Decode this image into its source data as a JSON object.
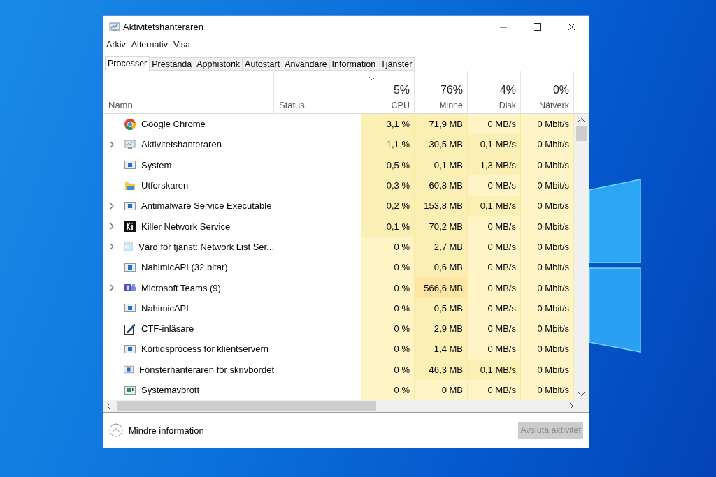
{
  "window": {
    "title": "Aktivitetshanteraren"
  },
  "menu": [
    "Arkiv",
    "Alternativ",
    "Visa"
  ],
  "tabs": [
    {
      "label": "Processer",
      "selected": true
    },
    {
      "label": "Prestanda",
      "selected": false
    },
    {
      "label": "Apphistorik",
      "selected": false
    },
    {
      "label": "Autostart",
      "selected": false
    },
    {
      "label": "Användare",
      "selected": false
    },
    {
      "label": "Information",
      "selected": false
    },
    {
      "label": "Tjänster",
      "selected": false
    }
  ],
  "columns": [
    {
      "kind": "name",
      "label": "Namn"
    },
    {
      "kind": "status",
      "label": "Status"
    },
    {
      "kind": "metric",
      "label": "CPU",
      "total": "5%",
      "sorted": true
    },
    {
      "kind": "metric",
      "label": "Minne",
      "total": "76%",
      "sorted": false
    },
    {
      "kind": "metric",
      "label": "Disk",
      "total": "4%",
      "sorted": false
    },
    {
      "kind": "metric",
      "label": "Nätverk",
      "total": "0%",
      "sorted": false
    }
  ],
  "rows": [
    {
      "name": "Google Chrome",
      "expandable": false,
      "kind": "chrome",
      "cells": [
        {
          "text": "3,1 %",
          "color": "#fcefb4"
        },
        {
          "text": "71,9 MB",
          "color": "#fcefb4"
        },
        {
          "text": "0 MB/s",
          "color": "#fff4c6"
        },
        {
          "text": "0 Mbit/s",
          "color": "#fff4c6"
        }
      ]
    },
    {
      "name": "Aktivitetshanteraren",
      "expandable": true,
      "kind": "taskmgr",
      "cells": [
        {
          "text": "1,1 %",
          "color": "#fcefb4"
        },
        {
          "text": "30,5 MB",
          "color": "#fcefb4"
        },
        {
          "text": "0,1 MB/s",
          "color": "#fcefb4"
        },
        {
          "text": "0 Mbit/s",
          "color": "#fff4c6"
        }
      ]
    },
    {
      "name": "System",
      "expandable": false,
      "kind": "app",
      "cells": [
        {
          "text": "0,5 %",
          "color": "#fcefb4"
        },
        {
          "text": "0,1 MB",
          "color": "#fcefb4"
        },
        {
          "text": "1,3 MB/s",
          "color": "#fcefb4"
        },
        {
          "text": "0 Mbit/s",
          "color": "#fff4c6"
        }
      ]
    },
    {
      "name": "Utforskaren",
      "expandable": false,
      "kind": "folder",
      "cells": [
        {
          "text": "0,3 %",
          "color": "#fcefb4"
        },
        {
          "text": "60,8 MB",
          "color": "#fcefb4"
        },
        {
          "text": "0 MB/s",
          "color": "#fff4c6"
        },
        {
          "text": "0 Mbit/s",
          "color": "#fff4c6"
        }
      ]
    },
    {
      "name": "Antimalware Service Executable",
      "expandable": true,
      "kind": "app",
      "cells": [
        {
          "text": "0,2 %",
          "color": "#fcefb4"
        },
        {
          "text": "153,8 MB",
          "color": "#fcefb4"
        },
        {
          "text": "0,1 MB/s",
          "color": "#fcefb4"
        },
        {
          "text": "0 Mbit/s",
          "color": "#fff4c6"
        }
      ]
    },
    {
      "name": "Killer Network Service",
      "expandable": true,
      "kind": "killer",
      "cells": [
        {
          "text": "0,1 %",
          "color": "#fcefb4"
        },
        {
          "text": "70,2 MB",
          "color": "#fcefb4"
        },
        {
          "text": "0 MB/s",
          "color": "#fff4c6"
        },
        {
          "text": "0 Mbit/s",
          "color": "#fff4c6"
        }
      ]
    },
    {
      "name": "Värd för tjänst: Network List Ser...",
      "expandable": true,
      "kind": "gear",
      "cells": [
        {
          "text": "0 %",
          "color": "#fff4c6"
        },
        {
          "text": "2,7 MB",
          "color": "#fcefb4"
        },
        {
          "text": "0 MB/s",
          "color": "#fff4c6"
        },
        {
          "text": "0 Mbit/s",
          "color": "#fff4c6"
        }
      ]
    },
    {
      "name": "NahimicAPI (32 bitar)",
      "expandable": false,
      "kind": "app",
      "cells": [
        {
          "text": "0 %",
          "color": "#fff4c6"
        },
        {
          "text": "0,6 MB",
          "color": "#fcefb4"
        },
        {
          "text": "0 MB/s",
          "color": "#fff4c6"
        },
        {
          "text": "0 Mbit/s",
          "color": "#fff4c6"
        }
      ]
    },
    {
      "name": "Microsoft Teams (9)",
      "expandable": true,
      "kind": "teams",
      "cells": [
        {
          "text": "0 %",
          "color": "#fff4c6"
        },
        {
          "text": "566,6 MB",
          "color": "#fde6a2"
        },
        {
          "text": "0 MB/s",
          "color": "#fff4c6"
        },
        {
          "text": "0 Mbit/s",
          "color": "#fff4c6"
        }
      ]
    },
    {
      "name": "NahimicAPI",
      "expandable": false,
      "kind": "app",
      "cells": [
        {
          "text": "0 %",
          "color": "#fff4c6"
        },
        {
          "text": "0,5 MB",
          "color": "#fcefb4"
        },
        {
          "text": "0 MB/s",
          "color": "#fff4c6"
        },
        {
          "text": "0 Mbit/s",
          "color": "#fff4c6"
        }
      ]
    },
    {
      "name": "CTF-inläsare",
      "expandable": false,
      "kind": "ctf",
      "cells": [
        {
          "text": "0 %",
          "color": "#fff4c6"
        },
        {
          "text": "2,9 MB",
          "color": "#fcefb4"
        },
        {
          "text": "0 MB/s",
          "color": "#fff4c6"
        },
        {
          "text": "0 Mbit/s",
          "color": "#fff4c6"
        }
      ]
    },
    {
      "name": "Körtidsprocess för klientservern",
      "expandable": false,
      "kind": "app",
      "cells": [
        {
          "text": "0 %",
          "color": "#fff4c6"
        },
        {
          "text": "1,4 MB",
          "color": "#fcefb4"
        },
        {
          "text": "0 MB/s",
          "color": "#fff4c6"
        },
        {
          "text": "0 Mbit/s",
          "color": "#fff4c6"
        }
      ]
    },
    {
      "name": "Fönsterhanteraren för skrivbordet",
      "expandable": false,
      "kind": "app",
      "cells": [
        {
          "text": "0 %",
          "color": "#fff4c6"
        },
        {
          "text": "46,3 MB",
          "color": "#fcefb4"
        },
        {
          "text": "0,1 MB/s",
          "color": "#fcefb4"
        },
        {
          "text": "0 Mbit/s",
          "color": "#fff4c6"
        }
      ]
    },
    {
      "name": "Systemavbrott",
      "expandable": false,
      "kind": "interrupt",
      "cells": [
        {
          "text": "0 %",
          "color": "#fff4c6"
        },
        {
          "text": "0 MB",
          "color": "#fff4c6"
        },
        {
          "text": "0 MB/s",
          "color": "#fff4c6"
        },
        {
          "text": "0 Mbit/s",
          "color": "#fff4c6"
        }
      ]
    }
  ],
  "footer": {
    "toggle": "Mindre information",
    "end_task": {
      "label": "Avsluta aktivitet",
      "disabled": true
    }
  }
}
